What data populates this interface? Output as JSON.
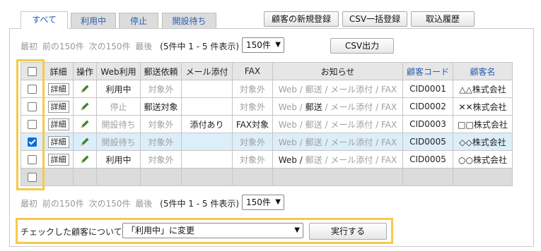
{
  "tabs": [
    {
      "label": "すべて",
      "active": true
    },
    {
      "label": "利用中",
      "active": false
    },
    {
      "label": "停止",
      "active": false
    },
    {
      "label": "開設待ち",
      "active": false
    }
  ],
  "toolbar": {
    "new_customer": "顧客の新規登録",
    "csv_import": "CSV一括登録",
    "import_history": "取込履歴",
    "csv_export": "CSV出力"
  },
  "pager": {
    "first": "最初",
    "prev": "前の150件",
    "next": "次の150件",
    "last": "最後",
    "info": "(5件中 1 - 5 件表示)",
    "per_page": "150件"
  },
  "table": {
    "headers": [
      "詳細",
      "操作",
      "Web利用",
      "郵送依頼",
      "メール添付",
      "FAX",
      "お知らせ",
      "顧客コード",
      "顧客名"
    ],
    "sortable": [
      false,
      false,
      false,
      false,
      false,
      false,
      false,
      true,
      true
    ],
    "rows": [
      {
        "checked": false,
        "detail": "詳細",
        "web": "利用中",
        "web_gray": false,
        "mail": "対象外",
        "mail_gray": true,
        "attach": "",
        "fax": "対象外",
        "fax_gray": true,
        "notice": [
          {
            "t": "Web / ",
            "g": true
          },
          {
            "t": "郵送",
            "g": true
          },
          {
            "t": " / ",
            "g": true
          },
          {
            "t": "メール添付",
            "g": true
          },
          {
            "t": " / FAX",
            "g": true
          }
        ],
        "code": "CID0001",
        "name": "△△株式会社"
      },
      {
        "checked": false,
        "detail": "詳細",
        "web": "停止",
        "web_gray": true,
        "mail": "郵送対象",
        "mail_gray": false,
        "attach": "",
        "fax": "対象外",
        "fax_gray": true,
        "notice": [
          {
            "t": "Web / ",
            "g": true
          },
          {
            "t": "郵送",
            "g": false
          },
          {
            "t": " / ",
            "g": true
          },
          {
            "t": "メール添付",
            "g": true
          },
          {
            "t": " / FAX",
            "g": true
          }
        ],
        "code": "CID0002",
        "name": "✕✕株式会社"
      },
      {
        "checked": false,
        "detail": "詳細",
        "web": "開設待ち",
        "web_gray": true,
        "mail": "対象外",
        "mail_gray": true,
        "attach": "添付あり",
        "fax": "FAX対象",
        "fax_gray": false,
        "notice": [
          {
            "t": "Web / ",
            "g": true
          },
          {
            "t": "郵送",
            "g": true
          },
          {
            "t": " / ",
            "g": true
          },
          {
            "t": "メール添付",
            "g": true
          },
          {
            "t": " / FAX",
            "g": true
          }
        ],
        "code": "CID0003",
        "name": "□□株式会社"
      },
      {
        "checked": true,
        "detail": "詳細",
        "web": "開設待ち",
        "web_gray": true,
        "mail": "対象外",
        "mail_gray": true,
        "attach": "",
        "fax": "対象外",
        "fax_gray": true,
        "notice": [
          {
            "t": "Web / ",
            "g": true
          },
          {
            "t": "郵送",
            "g": true
          },
          {
            "t": " / ",
            "g": true
          },
          {
            "t": "メール添付",
            "g": true
          },
          {
            "t": " / FAX",
            "g": true
          }
        ],
        "code": "CID0005",
        "name": "◇◇株式会社"
      },
      {
        "checked": false,
        "detail": "詳細",
        "web": "利用中",
        "web_gray": false,
        "mail": "対象外",
        "mail_gray": true,
        "attach": "",
        "fax": "対象外",
        "fax_gray": true,
        "notice": [
          {
            "t": "Web / ",
            "g": false
          },
          {
            "t": "郵送",
            "g": true
          },
          {
            "t": " / ",
            "g": true
          },
          {
            "t": "メール添付",
            "g": true
          },
          {
            "t": " / FAX",
            "g": true
          }
        ],
        "code": "CID0005",
        "name": "○○株式会社"
      }
    ]
  },
  "bulk": {
    "label": "チェックした顧客について",
    "action": "「利用中」に変更",
    "execute": "実行する"
  },
  "colors": {
    "link": "#2a5db0",
    "highlight": "#f6c94a",
    "selected_row": "#dceefa",
    "check": "#0a6fd6"
  }
}
